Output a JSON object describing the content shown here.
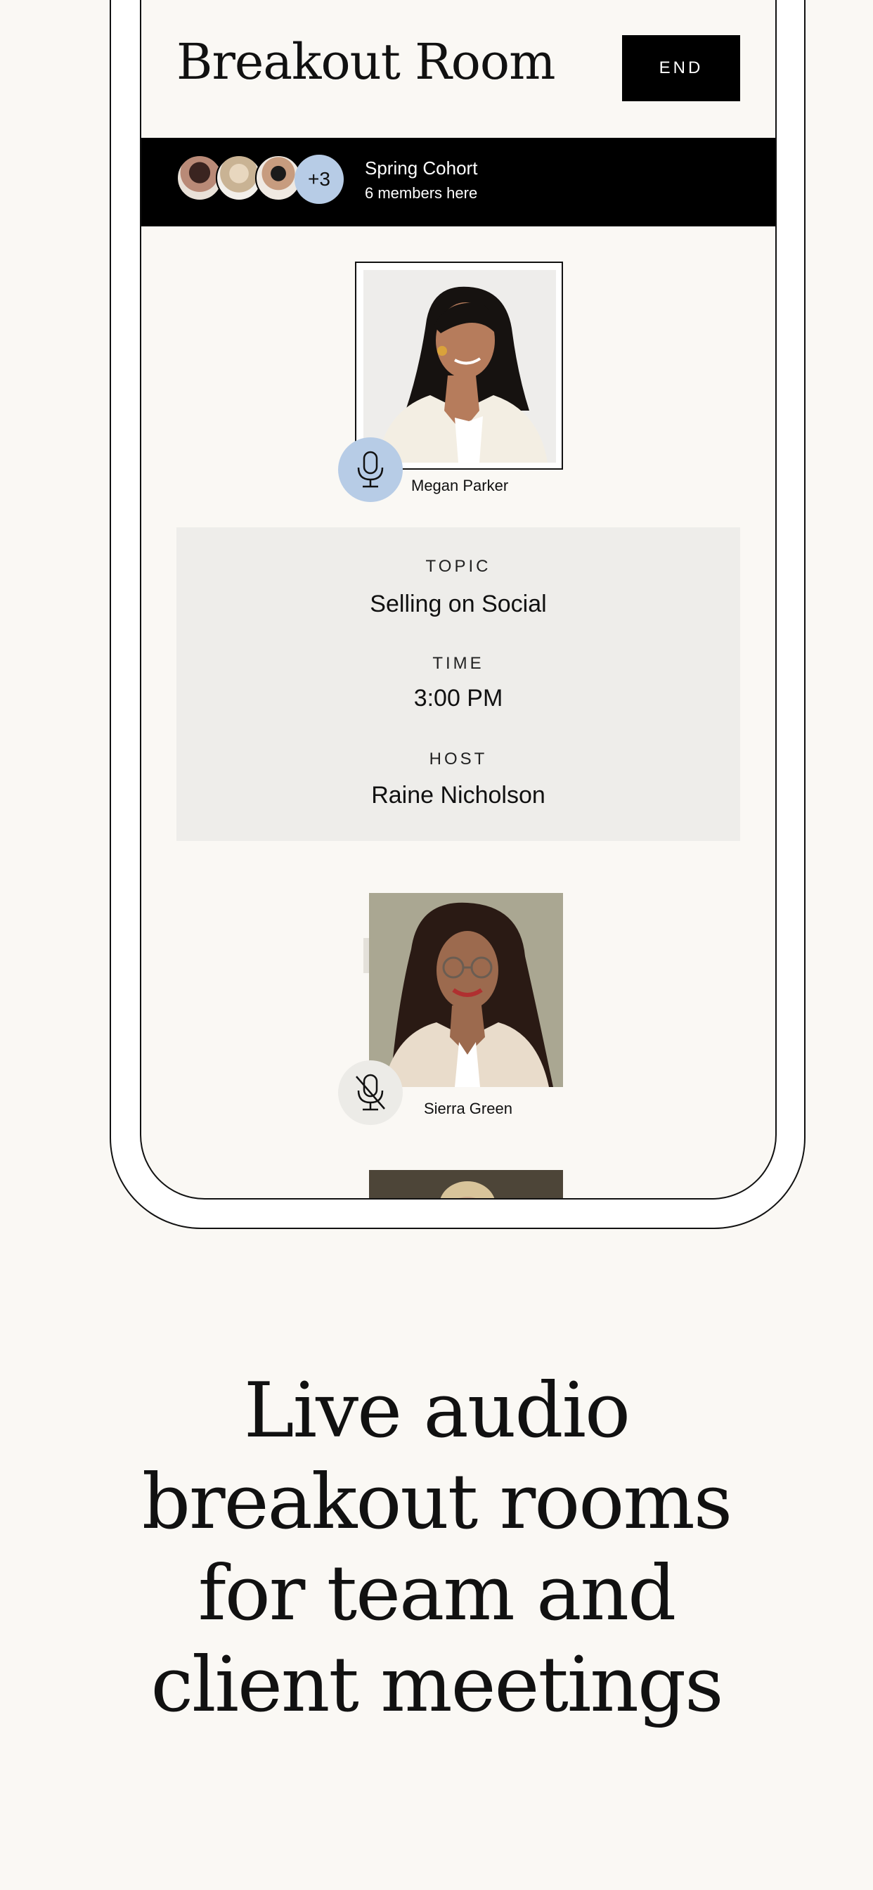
{
  "header": {
    "title": "Breakout Room",
    "end_label": "END"
  },
  "cohort": {
    "name": "Spring Cohort",
    "members_text": "6 members here",
    "extra_count": "+3"
  },
  "participants": [
    {
      "name": "Megan Parker",
      "mic": "mic-icon",
      "muted": false
    },
    {
      "name": "Sierra Green",
      "mic": "mic-off-icon",
      "muted": true
    }
  ],
  "room_info": {
    "topic_label": "TOPIC",
    "topic": "Selling on Social",
    "time_label": "TIME",
    "time": "3:00 PM",
    "host_label": "HOST",
    "host": "Raine Nicholson"
  },
  "tagline": {
    "lines": [
      "Live audio",
      "breakout rooms",
      "for team and",
      "client meetings"
    ]
  },
  "colors": {
    "background": "#faf8f4",
    "accent_blue": "#b7cce6",
    "black": "#000000",
    "card": "#eeedea"
  }
}
